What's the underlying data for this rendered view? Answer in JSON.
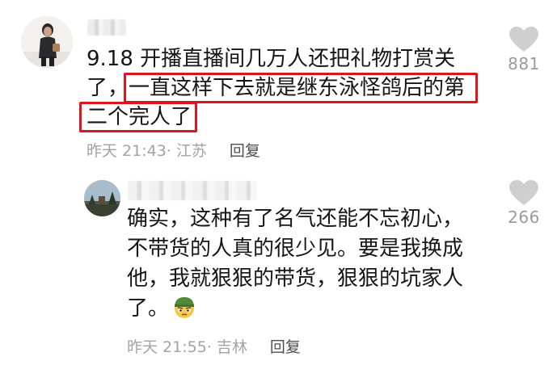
{
  "comment": {
    "lines": [
      "9.18 开播直播间几万人还把礼物打赏关",
      "了，一直这样下去就是继东泳怪鸽后的第",
      "二个完人了"
    ],
    "line2_prefix": "了，",
    "line2_highlight": "一直这样下去就是继东泳怪鸽后的第",
    "line3_highlight": "二个完人了",
    "time": "昨天 21:43",
    "location": "· 江苏",
    "reply_label": "回复",
    "like_count": "881",
    "highlight_color": "#e0141c"
  },
  "reply": {
    "lines": [
      "确实，这种有了名气还能不忘初心，",
      "不带货的人真的很少见。要是我换成",
      "他，我就狠狠的带货，狠狠的坑家人",
      "了。"
    ],
    "emoji": "soldier-face-emoji",
    "time": "昨天 21:55",
    "location": "· 吉林",
    "reply_label": "回复",
    "like_count": "266"
  },
  "icons": {
    "heart": "heart-icon",
    "heart_color": "#cfcfcf"
  }
}
